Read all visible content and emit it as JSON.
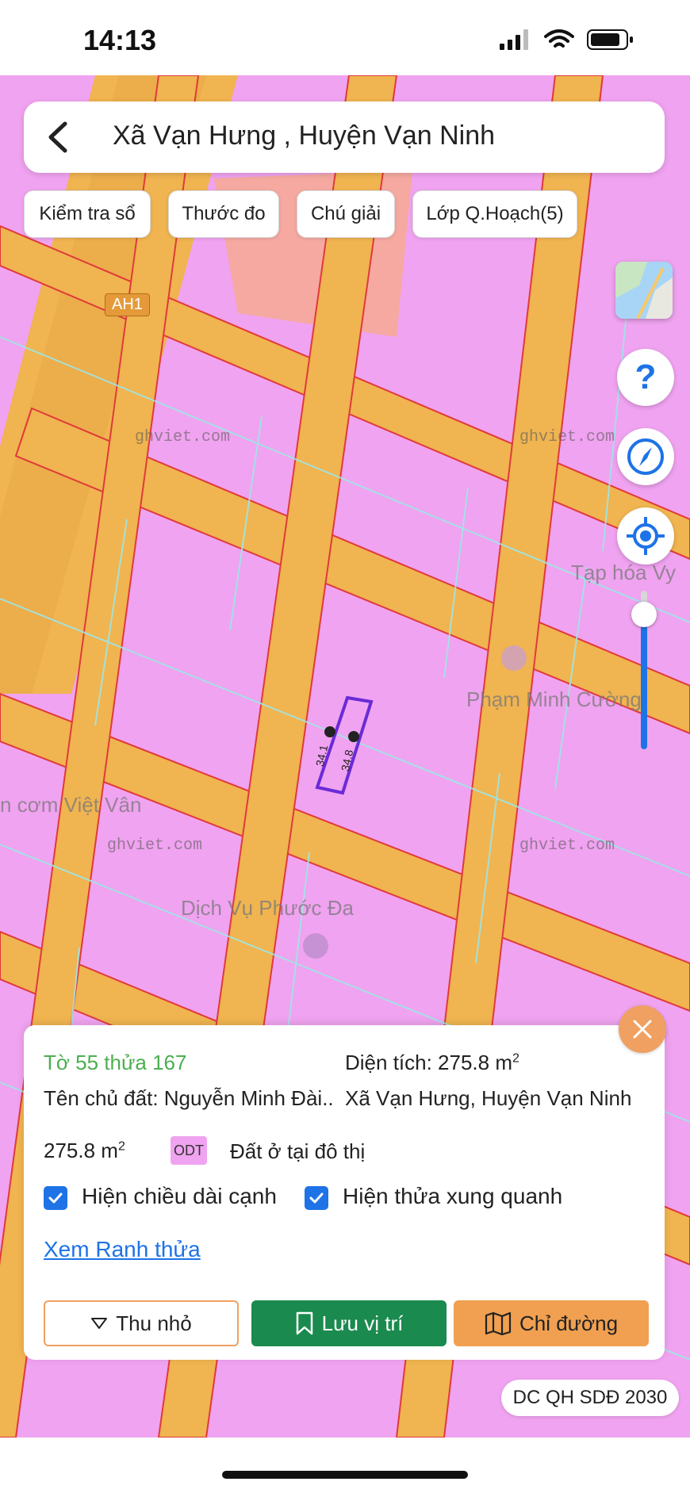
{
  "status_bar": {
    "time": "14:13"
  },
  "header": {
    "title": "Xã Vạn Hưng , Huyện Vạn Ninh"
  },
  "chips": [
    "Kiểm tra sổ",
    "Thước đo",
    "Chú giải",
    "Lớp Q.Hoạch(5)"
  ],
  "map": {
    "road_label": "AH1",
    "watermark": "ghviet.com",
    "labels": {
      "shop_1": "Tạp hóa Vy",
      "shop_2": "Phạm Minh Cường",
      "shop_3": "n cơm Việt Vân",
      "shop_4": "Dịch Vụ Phước Đa"
    },
    "edge_1": "34.1",
    "edge_2": "34.8"
  },
  "side_buttons": {
    "help": "?",
    "zoom_level": 0.85
  },
  "info": {
    "parcel": "Tờ 55 thửa 167",
    "area_label": "Diện tích: 275.8 m",
    "area_sup": "2",
    "owner": "Tên chủ đất: Nguyễn Minh Đài..",
    "location": "Xã Vạn Hưng, Huyện Vạn Ninh",
    "area_value": "275.8 m",
    "area_value_sup": "2",
    "land_code": "ODT",
    "land_type": "Đất ở tại đô thị",
    "checkbox_edges": "Hiện chiều dài cạnh",
    "checkbox_neighbors": "Hiện thửa xung quanh",
    "link": "Xem Ranh thửa"
  },
  "buttons": {
    "collapse": "Thu nhỏ",
    "save": "Lưu vị trí",
    "directions": "Chỉ đường"
  },
  "plan_badge": "DC QH SDĐ 2030",
  "colors": {
    "residential": "#f0a3f0",
    "road": "#f0b450",
    "accent": "#1e73e6",
    "save_button": "#1a8a4e",
    "directions_button": "#f0a050"
  }
}
